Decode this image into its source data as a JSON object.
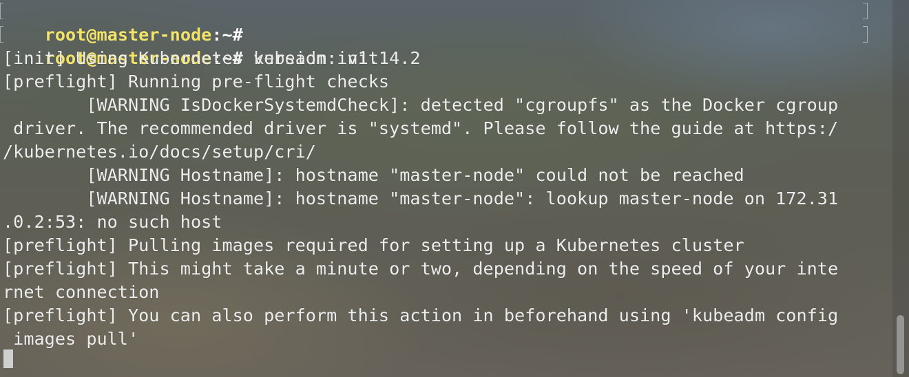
{
  "prompt": {
    "user": "root",
    "at": "@",
    "host": "master-node",
    "path": ":~#"
  },
  "command": " kubeadm init",
  "output": [
    "[init] Using Kubernetes version: v1.14.2",
    "[preflight] Running pre-flight checks",
    "        [WARNING IsDockerSystemdCheck]: detected \"cgroupfs\" as the Docker cgroup",
    " driver. The recommended driver is \"systemd\". Please follow the guide at https:/",
    "/kubernetes.io/docs/setup/cri/",
    "        [WARNING Hostname]: hostname \"master-node\" could not be reached",
    "        [WARNING Hostname]: hostname \"master-node\": lookup master-node on 172.31",
    ".0.2:53: no such host",
    "[preflight] Pulling images required for setting up a Kubernetes cluster",
    "[preflight] This might take a minute or two, depending on the speed of your inte",
    "rnet connection",
    "[preflight] You can also perform this action in beforehand using 'kubeadm config",
    " images pull'"
  ]
}
